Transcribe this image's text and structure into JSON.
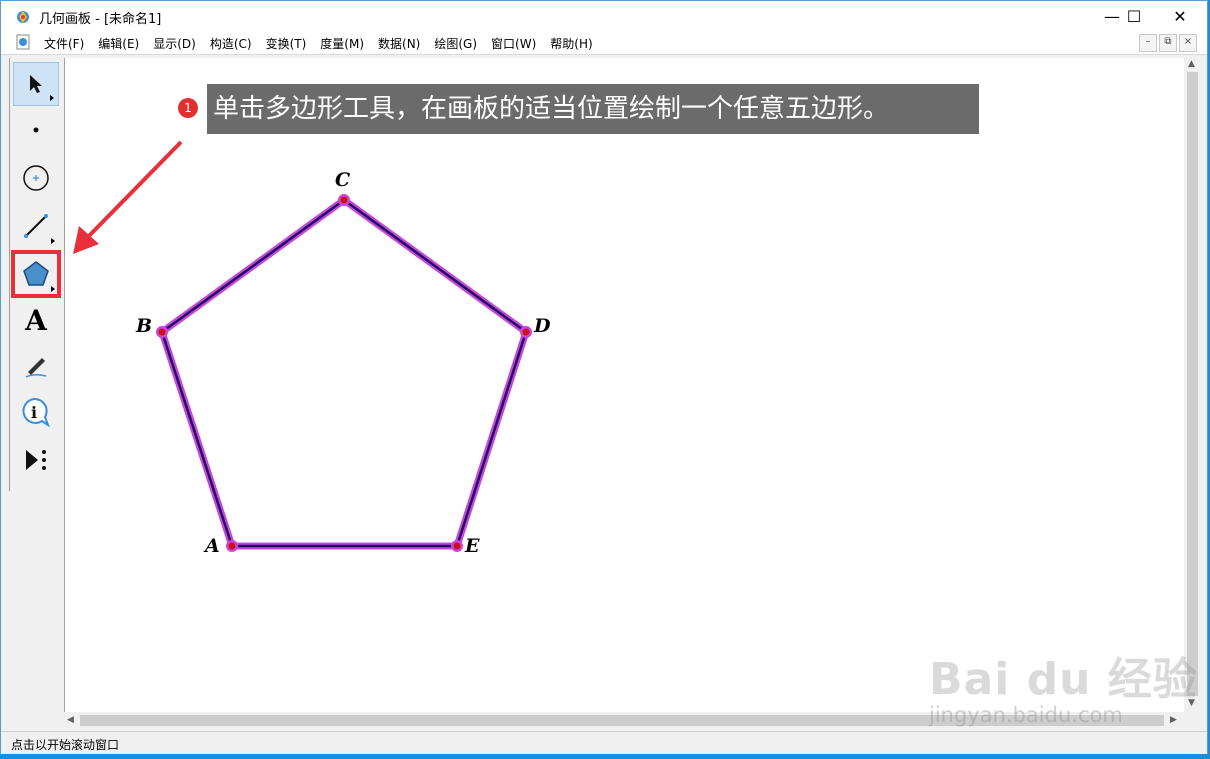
{
  "window": {
    "title": "几何画板 - [未命名1]",
    "controls": {
      "minimize": "—",
      "maximize": "☐",
      "close": "✕"
    }
  },
  "menu": {
    "items": [
      {
        "label": "文件(F)"
      },
      {
        "label": "编辑(E)"
      },
      {
        "label": "显示(D)"
      },
      {
        "label": "构造(C)"
      },
      {
        "label": "变换(T)"
      },
      {
        "label": "度量(M)"
      },
      {
        "label": "数据(N)"
      },
      {
        "label": "绘图(G)"
      },
      {
        "label": "窗口(W)"
      },
      {
        "label": "帮助(H)"
      }
    ],
    "mdi_controls": [
      "–",
      "⧉",
      "×"
    ]
  },
  "toolbox": {
    "tools": [
      {
        "name": "arrow-select-tool",
        "icon": "arrow-icon"
      },
      {
        "name": "point-tool",
        "icon": "point-icon"
      },
      {
        "name": "compass-tool",
        "icon": "circle-icon"
      },
      {
        "name": "straightedge-tool",
        "icon": "segment-icon"
      },
      {
        "name": "polygon-tool",
        "icon": "pentagon-icon"
      },
      {
        "name": "text-tool",
        "icon": "text-a-icon",
        "glyph": "A"
      },
      {
        "name": "marker-tool",
        "icon": "pen-icon"
      },
      {
        "name": "information-tool",
        "icon": "info-icon",
        "glyph": "i"
      },
      {
        "name": "custom-tool",
        "icon": "play-more-icon"
      }
    ],
    "selected": "arrow-select-tool",
    "highlighted": "polygon-tool"
  },
  "annotation": {
    "step": "1",
    "text": "单击多边形工具，在画板的适当位置绘制一个任意五边形。",
    "arrow_color": "#e8303a"
  },
  "figure": {
    "points": [
      {
        "label": "A"
      },
      {
        "label": "B"
      },
      {
        "label": "C"
      },
      {
        "label": "D"
      },
      {
        "label": "E"
      }
    ],
    "edge_color": "#1a1060",
    "highlight_color": "#cc44dd",
    "point_color": "#cc1111"
  },
  "status": {
    "text": "点击以开始滚动窗口"
  },
  "watermark": {
    "logo": "Bai du 经验",
    "url": "jingyan.baidu.com"
  }
}
